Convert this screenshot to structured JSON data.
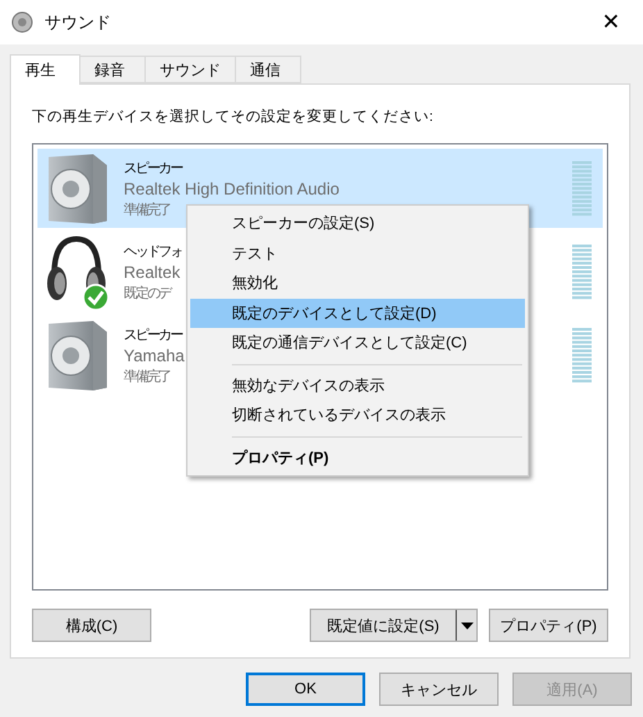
{
  "window": {
    "title": "サウンド",
    "close": "✕"
  },
  "tabs": [
    {
      "label": "再生",
      "selected": true
    },
    {
      "label": "録音",
      "selected": false
    },
    {
      "label": "サウンド",
      "selected": false
    },
    {
      "label": "通信",
      "selected": false
    }
  ],
  "instruction": "下の再生デバイスを選択してその設定を変更してください:",
  "devices": [
    {
      "kind": "speaker",
      "name": "スピーカー",
      "driver": "Realtek High Definition Audio",
      "status": "準備完了",
      "selected": true,
      "default": false
    },
    {
      "kind": "headphones",
      "name": "ヘッドフォ",
      "driver": "Realtek",
      "status": "既定のデ",
      "selected": false,
      "default": true
    },
    {
      "kind": "speaker",
      "name": "スピーカー",
      "driver": "Yamaha",
      "status": "準備完了",
      "selected": false,
      "default": false
    }
  ],
  "context_menu": [
    {
      "kind": "item",
      "label": "スピーカーの設定(S)",
      "selected": false,
      "bold": false
    },
    {
      "kind": "item",
      "label": "テスト",
      "selected": false,
      "bold": false
    },
    {
      "kind": "item",
      "label": "無効化",
      "selected": false,
      "bold": false
    },
    {
      "kind": "item",
      "label": "既定のデバイスとして設定(D)",
      "selected": true,
      "bold": false
    },
    {
      "kind": "item",
      "label": "既定の通信デバイスとして設定(C)",
      "selected": false,
      "bold": false
    },
    {
      "kind": "separator"
    },
    {
      "kind": "item",
      "label": "無効なデバイスの表示",
      "selected": false,
      "bold": false
    },
    {
      "kind": "item",
      "label": "切断されているデバイスの表示",
      "selected": false,
      "bold": false
    },
    {
      "kind": "separator"
    },
    {
      "kind": "item",
      "label": "プロパティ(P)",
      "selected": false,
      "bold": true
    }
  ],
  "panel_buttons": {
    "configure": "構成(C)",
    "set_default": "既定値に設定(S)",
    "properties": "プロパティ(P)"
  },
  "dialog_buttons": [
    {
      "label": "OK",
      "kind": "primary",
      "disabled": false
    },
    {
      "label": "キャンセル",
      "kind": "normal",
      "disabled": false
    },
    {
      "label": "適用(A)",
      "kind": "normal",
      "disabled": true
    }
  ]
}
